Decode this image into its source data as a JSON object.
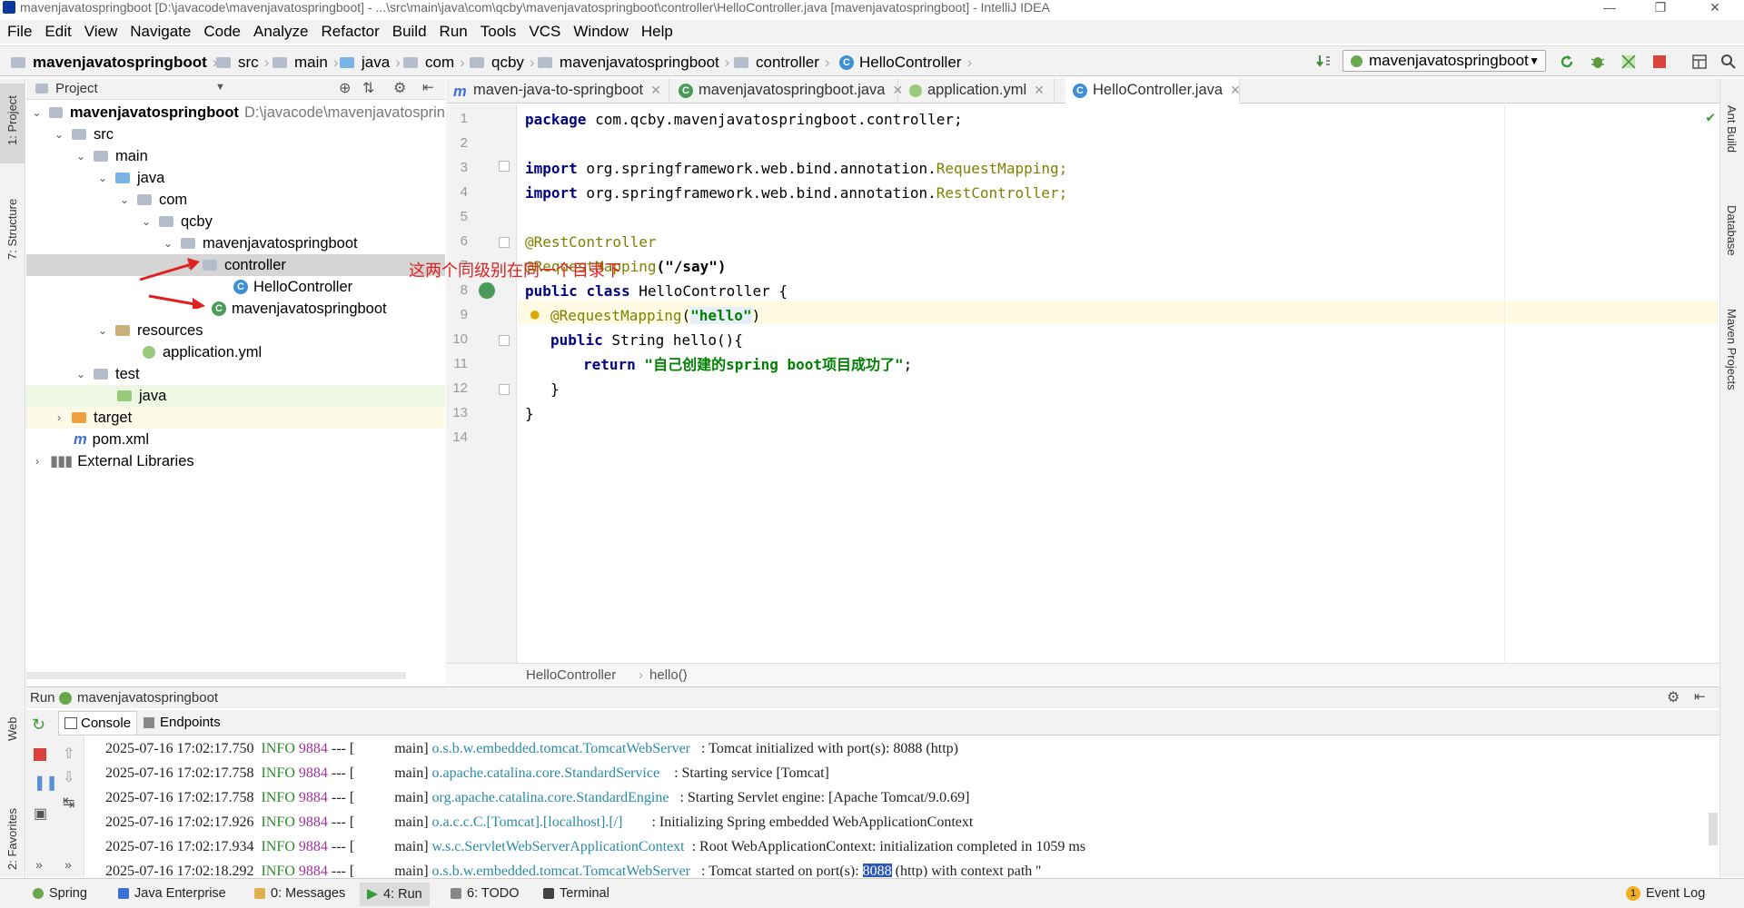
{
  "window": {
    "title": "mavenjavatospringboot [D:\\javacode\\mavenjavatospringboot] - ...\\src\\main\\java\\com\\qcby\\mavenjavatospringboot\\controller\\HelloController.java [mavenjavatospringboot] - IntelliJ IDEA"
  },
  "menu": [
    "File",
    "Edit",
    "View",
    "Navigate",
    "Code",
    "Analyze",
    "Refactor",
    "Build",
    "Run",
    "Tools",
    "VCS",
    "Window",
    "Help"
  ],
  "breadcrumb": [
    "mavenjavatospringboot",
    "src",
    "main",
    "java",
    "com",
    "qcby",
    "mavenjavatospringboot",
    "controller",
    "HelloController"
  ],
  "run_config": "mavenjavatospringboot",
  "left_stripe": {
    "project": "1: Project",
    "structure": "7: Structure",
    "web": "Web",
    "favorites": "2: Favorites"
  },
  "right_stripe": {
    "ant": "Ant Build",
    "database": "Database",
    "maven": "Maven Projects"
  },
  "project_panel": {
    "title": "Project",
    "root_label": "mavenjavatospringboot",
    "root_path": "D:\\javacode\\mavenjavatosprin",
    "tree": [
      "src",
      "main",
      "java",
      "com",
      "qcby",
      "mavenjavatospringboot",
      "controller",
      "HelloController",
      "mavenjavatospringboot",
      "resources",
      "application.yml",
      "test",
      "java",
      "target",
      "pom.xml",
      "External Libraries"
    ],
    "annotation": "这两个同级别在同一个目录下"
  },
  "editor": {
    "tabs": [
      "maven-java-to-springboot",
      "mavenjavatospringboot.java",
      "application.yml",
      "HelloController.java"
    ],
    "line_numbers": [
      "1",
      "2",
      "3",
      "4",
      "5",
      "6",
      "7",
      "8",
      "9",
      "10",
      "11",
      "12",
      "13",
      "14"
    ],
    "code": {
      "l1_kw": "package",
      "l1_rest": " com.qcby.mavenjavatospringboot.controller;",
      "l3_kw": "import",
      "l3_pkg": " org.springframework.web.bind.annotation.",
      "l3_cls": "RequestMapping",
      "l4_kw": "import",
      "l4_pkg": " org.springframework.web.bind.annotation.",
      "l4_cls": "RestController",
      "semi": ";",
      "l6": "@RestController",
      "l7_ann": "@RequestMapping",
      "l7_str": "(\"/say\")",
      "l8_kw1": "public",
      "l8_kw2": "class",
      "l8_rest": " HelloController {",
      "l9_ann": "@RequestMapping",
      "l9_open": "(",
      "l9_str": "\"hello\"",
      "l9_close": ")",
      "l10_kw": "public",
      "l10_rest": " String hello(){",
      "l11_kw": "return",
      "l11_str": " \"自己创建的spring boot项目成功了\"",
      "l12": "}",
      "l13": "}"
    },
    "footer_crumb": [
      "HelloController",
      "hello()"
    ]
  },
  "run_panel": {
    "label": "Run",
    "config": "mavenjavatospringboot",
    "tabs": [
      "Console",
      "Endpoints"
    ],
    "logs": [
      {
        "ts": "2025-07-16 17:02:17.750",
        "lvl": "INFO",
        "pid": "9884",
        "sep": "--- [",
        "thr": "main]",
        "logger": "o.s.b.w.embedded.tomcat.TomcatWebServer ",
        "msg": ": Tomcat initialized with port(s): 8088 (http)"
      },
      {
        "ts": "2025-07-16 17:02:17.758",
        "lvl": "INFO",
        "pid": "9884",
        "sep": "--- [",
        "thr": "main]",
        "logger": "o.apache.catalina.core.StandardService  ",
        "msg": ": Starting service [Tomcat]"
      },
      {
        "ts": "2025-07-16 17:02:17.758",
        "lvl": "INFO",
        "pid": "9884",
        "sep": "--- [",
        "thr": "main]",
        "logger": "org.apache.catalina.core.StandardEngine ",
        "msg": ": Starting Servlet engine: [Apache Tomcat/9.0.69]"
      },
      {
        "ts": "2025-07-16 17:02:17.926",
        "lvl": "INFO",
        "pid": "9884",
        "sep": "--- [",
        "thr": "main]",
        "logger": "o.a.c.c.C.[Tomcat].[localhost].[/]      ",
        "msg": ": Initializing Spring embedded WebApplicationContext"
      },
      {
        "ts": "2025-07-16 17:02:17.934",
        "lvl": "INFO",
        "pid": "9884",
        "sep": "--- [",
        "thr": "main]",
        "logger": "w.s.c.ServletWebServerApplicationContext",
        "msg": ": Root WebApplicationContext: initialization completed in 1059 ms"
      },
      {
        "ts": "2025-07-16 17:02:18.292",
        "lvl": "INFO",
        "pid": "9884",
        "sep": "--- [",
        "thr": "main]",
        "logger": "o.s.b.w.embedded.tomcat.TomcatWebServer ",
        "msg_pre": ": Tomcat started on port(s): ",
        "msg_port": "8088",
        "msg_post": " (http) with context path ''"
      }
    ]
  },
  "statusbar": {
    "items": [
      "Spring",
      "Java Enterprise",
      "0: Messages",
      "4: Run",
      "6: TODO",
      "Terminal"
    ],
    "event_log": "Event Log",
    "event_count": "1"
  },
  "colors": {
    "keyword": "#000080",
    "annotation": "#808000",
    "string": "#008000",
    "annotation_note": "#e02020",
    "selection": "#2b55b7"
  }
}
